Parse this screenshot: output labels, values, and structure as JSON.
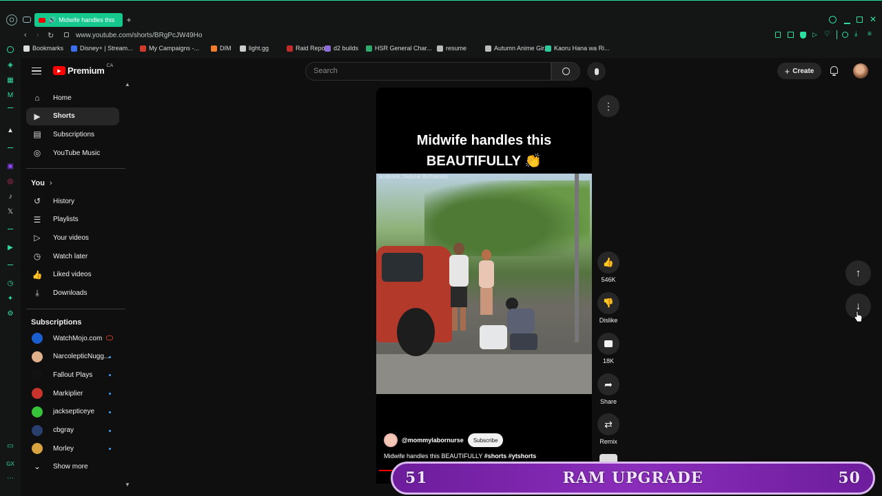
{
  "browser": {
    "tab_title": "Midwife handles this",
    "url": "www.youtube.com/shorts/BRgPcJW49Ho",
    "bookmarks": [
      {
        "label": "Bookmarks",
        "color": "#dddddd"
      },
      {
        "label": "Disney+ | Stream...",
        "color": "#3b6ff0"
      },
      {
        "label": "My Campaigns -...",
        "color": "#d23b2b"
      },
      {
        "label": "DIM",
        "color": "#f07d2b"
      },
      {
        "label": "light.gg",
        "color": "#cccccc"
      },
      {
        "label": "Raid Report",
        "color": "#c02a2a"
      },
      {
        "label": "d2 builds",
        "color": "#8b6cd8"
      },
      {
        "label": "HSR General Char...",
        "color": "#2eaa6a"
      },
      {
        "label": "resume",
        "color": "#bbbbbb"
      },
      {
        "label": "Autumn Anime Gir...",
        "color": "#bbbbbb"
      },
      {
        "label": "Kaoru Hana wa Ri...",
        "color": "#2ecc9a"
      }
    ]
  },
  "youtube": {
    "logo_text": "Premium",
    "logo_region": "CA",
    "search_placeholder": "Search",
    "create_label": "Create",
    "nav": [
      {
        "label": "Home",
        "icon": "home-icon"
      },
      {
        "label": "Shorts",
        "icon": "shorts-icon"
      },
      {
        "label": "Subscriptions",
        "icon": "subscriptions-icon"
      },
      {
        "label": "YouTube Music",
        "icon": "music-icon"
      }
    ],
    "you_title": "You",
    "you_items": [
      {
        "label": "History",
        "icon": "history-icon"
      },
      {
        "label": "Playlists",
        "icon": "playlists-icon"
      },
      {
        "label": "Your videos",
        "icon": "your-videos-icon"
      },
      {
        "label": "Watch later",
        "icon": "watch-later-icon"
      },
      {
        "label": "Liked videos",
        "icon": "liked-icon"
      },
      {
        "label": "Downloads",
        "icon": "download-icon"
      }
    ],
    "subscriptions_title": "Subscriptions",
    "subscriptions": [
      {
        "label": "WatchMojo.com",
        "color": "#1a5fd0",
        "indicator": "live"
      },
      {
        "label": "NarcolepticNugg...",
        "color": "#e0b08a",
        "indicator": "dot"
      },
      {
        "label": "Fallout Plays",
        "color": "#111111",
        "indicator": "dot"
      },
      {
        "label": "Markiplier",
        "color": "#c8342c",
        "indicator": "dot"
      },
      {
        "label": "jacksepticeye",
        "color": "#37c43a",
        "indicator": "dot"
      },
      {
        "label": "cbgray",
        "color": "#2a3f6e",
        "indicator": "dot"
      },
      {
        "label": "Morley",
        "color": "#d9a440",
        "indicator": "dot"
      }
    ],
    "show_more": "Show more"
  },
  "short": {
    "title_line1": "Midwife handles this",
    "title_line2": "BEAUTIFULLY 👏",
    "watermark": "acebook: Natural Birthworks",
    "channel": "@mommylabornurse",
    "subscribe": "Subscribe",
    "desc_text": "Midwife handles this BEAUTIFULLY ",
    "desc_tags": "#shorts #ytshorts",
    "likes": "546K",
    "dislike_label": "Dislike",
    "comments": "18K",
    "share_label": "Share",
    "remix_label": "Remix"
  },
  "overlay": {
    "left_number": "51",
    "title": "RAM UPGRADE",
    "right_number": "50"
  }
}
